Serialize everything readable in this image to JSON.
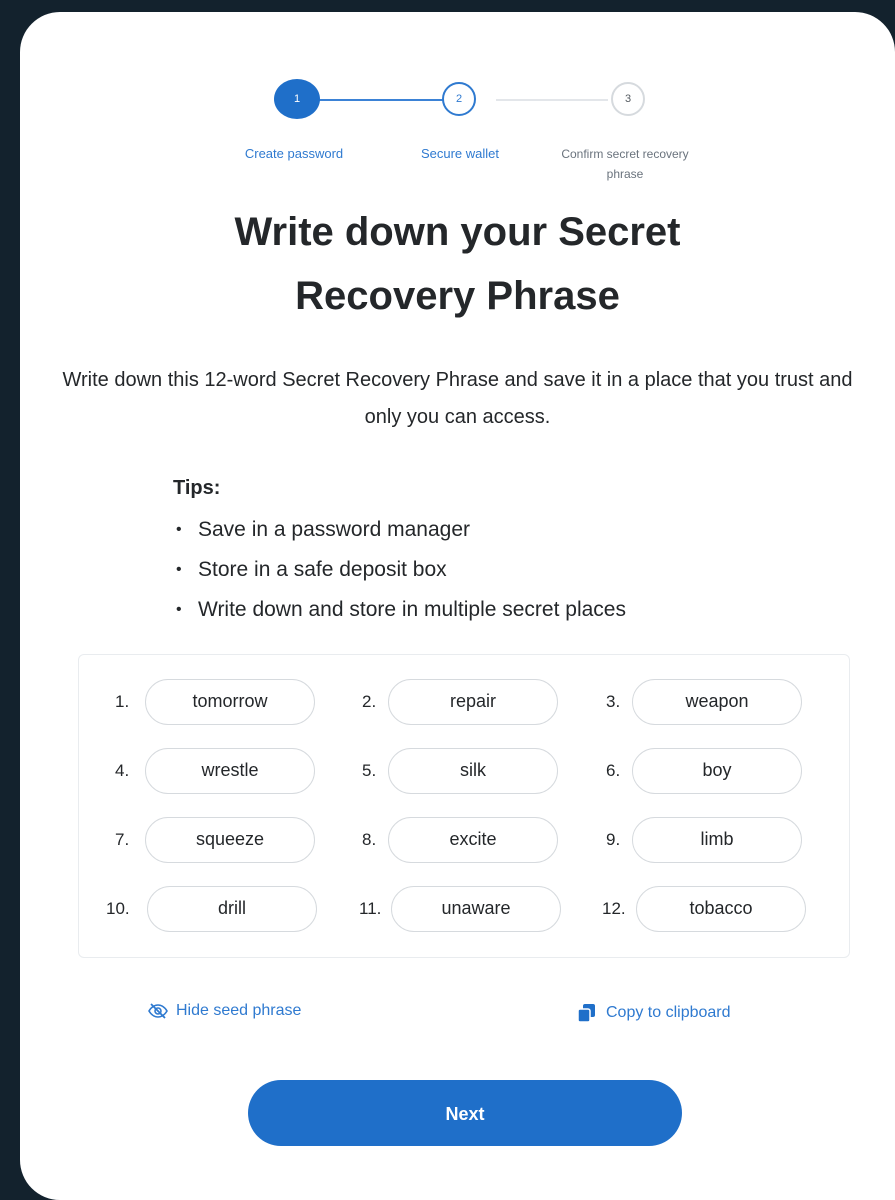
{
  "stepper": {
    "steps": [
      {
        "number": "1",
        "label": "Create password"
      },
      {
        "number": "2",
        "label": "Secure wallet"
      },
      {
        "number": "3",
        "label": "Confirm secret recovery phrase"
      }
    ]
  },
  "title": {
    "line1": "Write down your Secret",
    "line2": "Recovery Phrase"
  },
  "description": "Write down this 12-word Secret Recovery Phrase and save it in a place that you trust and only you can access.",
  "tips": {
    "heading": "Tips:",
    "items": [
      "Save in a password manager",
      "Store in a safe deposit box",
      "Write down and store in multiple secret places"
    ]
  },
  "phrase": {
    "words": [
      {
        "num": "1.",
        "word": "tomorrow"
      },
      {
        "num": "2.",
        "word": "repair"
      },
      {
        "num": "3.",
        "word": "weapon"
      },
      {
        "num": "4.",
        "word": "wrestle"
      },
      {
        "num": "5.",
        "word": "silk"
      },
      {
        "num": "6.",
        "word": "boy"
      },
      {
        "num": "7.",
        "word": "squeeze"
      },
      {
        "num": "8.",
        "word": "excite"
      },
      {
        "num": "9.",
        "word": "limb"
      },
      {
        "num": "10.",
        "word": "drill"
      },
      {
        "num": "11.",
        "word": "unaware"
      },
      {
        "num": "12.",
        "word": "tobacco"
      }
    ]
  },
  "actions": {
    "hide_label": "Hide seed phrase",
    "copy_label": "Copy to clipboard",
    "next_label": "Next"
  },
  "colors": {
    "background": "#13222d",
    "primary": "#1f6fc9",
    "link": "#2f7ad0"
  },
  "icons": {
    "hide": "eye-slash-icon",
    "copy": "copy-icon"
  }
}
